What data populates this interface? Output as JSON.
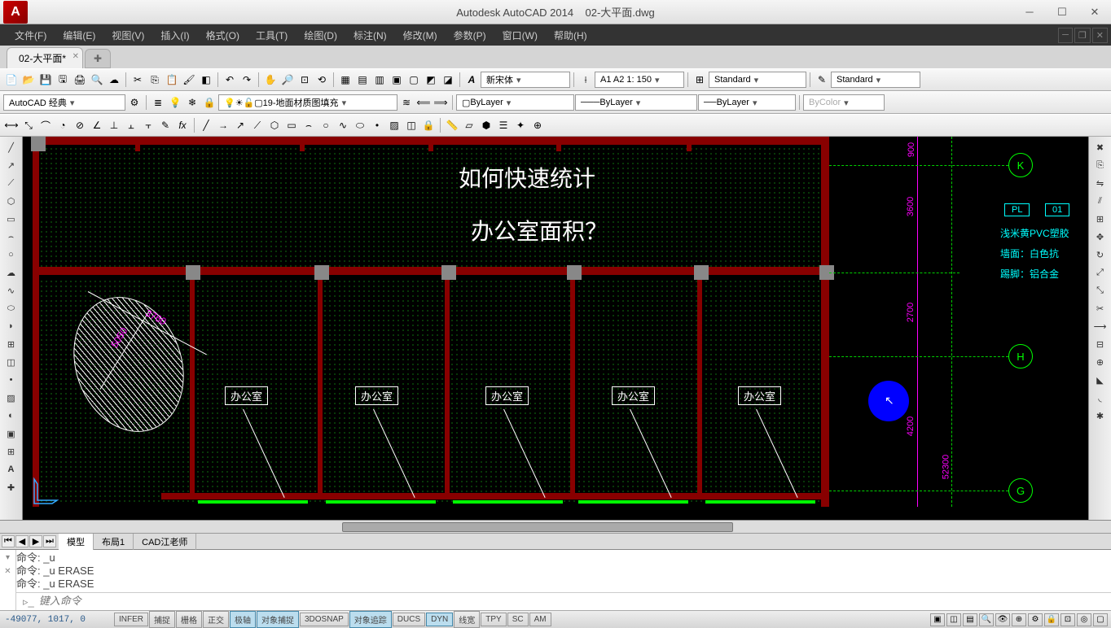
{
  "title": {
    "app": "Autodesk AutoCAD 2014",
    "file": "02-大平面.dwg"
  },
  "menu": {
    "items": [
      "文件(F)",
      "编辑(E)",
      "视图(V)",
      "插入(I)",
      "格式(O)",
      "工具(T)",
      "绘图(D)",
      "标注(N)",
      "修改(M)",
      "参数(P)",
      "窗口(W)",
      "帮助(H)"
    ]
  },
  "tabs": {
    "doc": "02-大平面*"
  },
  "toolbar1": {
    "font": "新宋体",
    "dimstyle": "A1 A2 1: 150",
    "tablestyle": "Standard",
    "mleader": "Standard"
  },
  "toolbar2": {
    "workspace": "AutoCAD 经典",
    "layer": "19-地面材质图填充",
    "color": "ByLayer",
    "linetype": "ByLayer",
    "lineweight": "ByLayer",
    "plotstyle": "ByColor"
  },
  "canvas": {
    "text1": "如何快速统计",
    "text2": "办公室面积？",
    "room": "办公室",
    "dims": {
      "d1": "900",
      "d2": "3600",
      "d3": "2700",
      "d4": "4200",
      "d5": "52300",
      "ell1": "5050",
      "ell2": "3760"
    },
    "grids": {
      "k": "K",
      "h": "H",
      "g": "G"
    },
    "notes": {
      "pl": "PL",
      "num": "01",
      "floor": "浅米黄PVC塑胶",
      "wall": "墙面：白色抗",
      "skirt": "踢脚：铝合金"
    }
  },
  "bottom_tabs": {
    "model": "模型",
    "layout1": "布局1",
    "teacher": "CAD江老师"
  },
  "cmd": {
    "l1": "命令:  _u",
    "l2": "命令:  _u ERASE",
    "l3": "命令:  _u ERASE",
    "placeholder": "键入命令",
    "prompt": "▹_"
  },
  "status": {
    "coords": "-49077, 1017, 0",
    "toggles": [
      "INFER",
      "捕捉",
      "栅格",
      "正交",
      "极轴",
      "对象捕捉",
      "3DOSNAP",
      "对象追踪",
      "DUCS",
      "DYN",
      "线宽",
      "TPY",
      "SC",
      "AM"
    ]
  }
}
